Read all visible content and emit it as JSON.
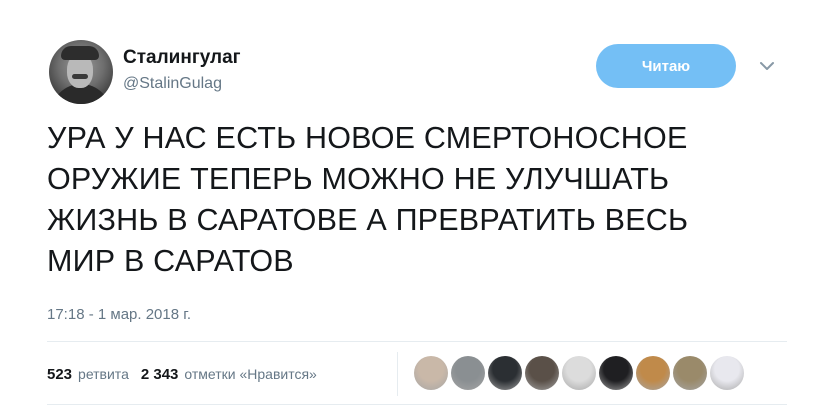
{
  "author": {
    "name": "Сталингулаг",
    "handle": "@StalinGulag"
  },
  "follow_button": {
    "label": "Читаю",
    "color": "#74bff5"
  },
  "menu_icon": "chevron-down-icon",
  "tweet": {
    "lines": [
      "УРА У НАС ЕСТЬ НОВОЕ СМЕРТОНОСНОЕ",
      "ОРУЖИЕ ТЕПЕРЬ МОЖНО НЕ УЛУЧШАТЬ",
      "ЖИЗНЬ В САРАТОВЕ А ПРЕВРАТИТЬ ВЕСЬ",
      "МИР В САРАТОВ"
    ],
    "timestamp": "17:18 - 1 мар. 2018 г."
  },
  "stats": {
    "retweets": {
      "count": "523",
      "label": "ретвита"
    },
    "likes": {
      "count": "2 343",
      "label": "отметки «Нравится»"
    }
  },
  "likers": [
    {
      "icon": "user-avatar-icon",
      "color": "#c9b8a8"
    },
    {
      "icon": "user-avatar-icon",
      "color": "#8a8f92"
    },
    {
      "icon": "user-avatar-icon",
      "color": "#2b2f33"
    },
    {
      "icon": "user-avatar-icon",
      "color": "#5a5048"
    },
    {
      "icon": "user-avatar-icon",
      "color": "#dcdcdc"
    },
    {
      "icon": "user-avatar-icon",
      "color": "#1f1f22"
    },
    {
      "icon": "user-avatar-icon",
      "color": "#c08a4a"
    },
    {
      "icon": "user-avatar-icon",
      "color": "#9a8a6a"
    },
    {
      "icon": "user-avatar-icon",
      "color": "#e8e8ee"
    }
  ],
  "colors": {
    "text": "#14171a",
    "secondary": "#657786",
    "divider": "#e6ecf0"
  }
}
